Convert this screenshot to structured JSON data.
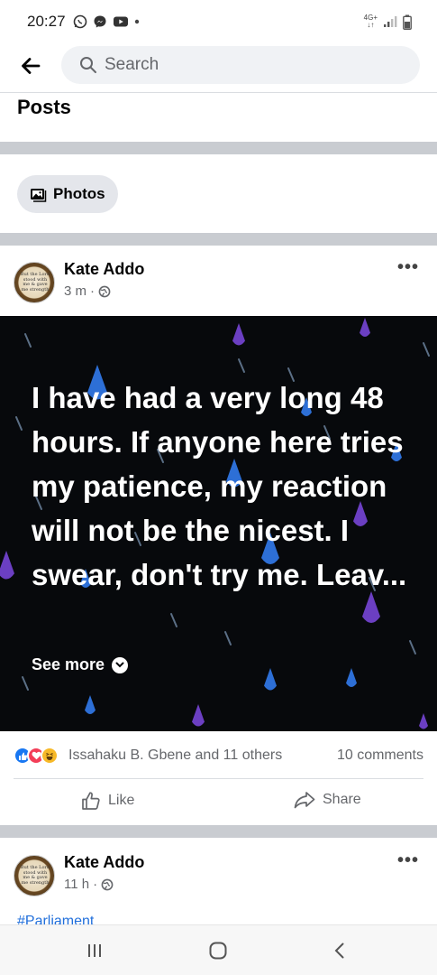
{
  "status_bar": {
    "time": "20:27",
    "network_label": "4G+",
    "network_sub": "↓↑"
  },
  "search": {
    "placeholder": "Search"
  },
  "section": {
    "title": "Posts"
  },
  "filter": {
    "photos_label": "Photos"
  },
  "posts": [
    {
      "author": "Kate Addo",
      "time": "3 m",
      "dot": "·",
      "avatar_text": "But the Lord stood with me & gave me strength",
      "text": "I have had a very long 48 hours. If anyone here tries my patience, my reaction will not be the nicest. I swear, don't try me. Leav...",
      "see_more": "See more",
      "reactions_summary": "Issahaku B. Gbene and 11 others",
      "comments": "10 comments",
      "like_label": "Like",
      "share_label": "Share"
    },
    {
      "author": "Kate Addo",
      "time": "11 h",
      "dot": "·",
      "avatar_text": "But the Lord stood with me & gave me strength",
      "hashtag": "#Parliament"
    }
  ],
  "colors": {
    "brand_blue": "#1877f2",
    "love_red": "#f33e58",
    "haha_yellow": "#f7b928",
    "post_bg": "#07090c",
    "drop_blue": "#2d6fd6",
    "drop_purple": "#6b3fc2"
  }
}
